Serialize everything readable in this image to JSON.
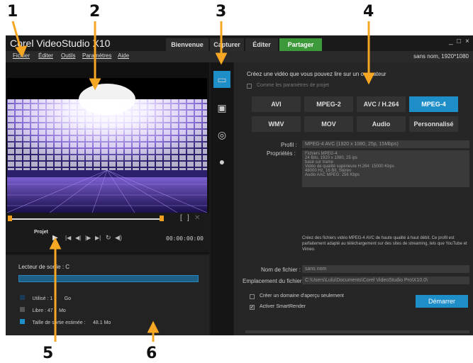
{
  "callouts": [
    "1",
    "2",
    "3",
    "4",
    "5",
    "6"
  ],
  "app": {
    "logo": "Corel VideoStudio X10",
    "tabs": [
      "Bienvenue",
      "Capturer",
      "Éditer",
      "Partager"
    ],
    "window_controls": [
      "_",
      "□",
      "×"
    ],
    "menu": [
      "Fichier",
      "Éditer",
      "Outils",
      "Paramètres",
      "Aide"
    ],
    "project_info": "sans nom, 1920*1080"
  },
  "player": {
    "project_label": "Projet",
    "timecode": "00:00:00:00",
    "controls": [
      "play",
      "start",
      "prev-frame",
      "next-frame",
      "end",
      "repeat",
      "volume"
    ]
  },
  "left_panel": {
    "drive_label": "Lecteur de sortie : C",
    "legend": [
      {
        "label": "Utilisé : 1",
        "value": "Go"
      },
      {
        "label": "Libre : 47",
        "value": "Mo"
      },
      {
        "label": "Taille de sortie estimée :",
        "value": "48.1 Mo"
      }
    ]
  },
  "right_panel": {
    "heading": "Créez une vidéo que vous pouvez lire sur un ordinateur",
    "same_as_project": "Comme les paramètres de projet",
    "formats": [
      "AVI",
      "MPEG-2",
      "AVC / H.264",
      "MPEG-4",
      "WMV",
      "MOV",
      "Audio",
      "Personnalisé"
    ],
    "active_format": "MPEG-4",
    "profile_label": "Profil :",
    "profile_value": "MPEG-4 AVC (1920 x 1080, 25p, 15Mbps)",
    "properties_label": "Propriétés :",
    "properties_lines": [
      "Fichiers MPEG-4",
      "24 Bits, 1920 x 1080, 25 ips",
      "basé sur trame",
      "Vidéo de qualité supérieure H.264: 15000 Kbps",
      "48000 Hz, 16 Bit, Stéréo",
      "Audio AAC MPEG: 256 Kbps"
    ],
    "description": "Créez des fichiers vidéo MPEG-4 AVC de haute qualité à haut débit. Ce profil est parfaitement adapté au téléchargement sur des sites de streaming, tels que YouTube et Vimeo.",
    "filename_label": "Nom de fichier :",
    "filename_value": "sans nom",
    "location_label": "Emplacement du fichier :",
    "location_value": "C:\\Users\\Lulu\\Documents\\Corel VideoStudio Pro\\X10.0\\",
    "preview_range_label": "Créer un domaine d'aperçu seulement",
    "smartrender_label": "Activer SmartRender",
    "start_button": "Démarrer"
  }
}
